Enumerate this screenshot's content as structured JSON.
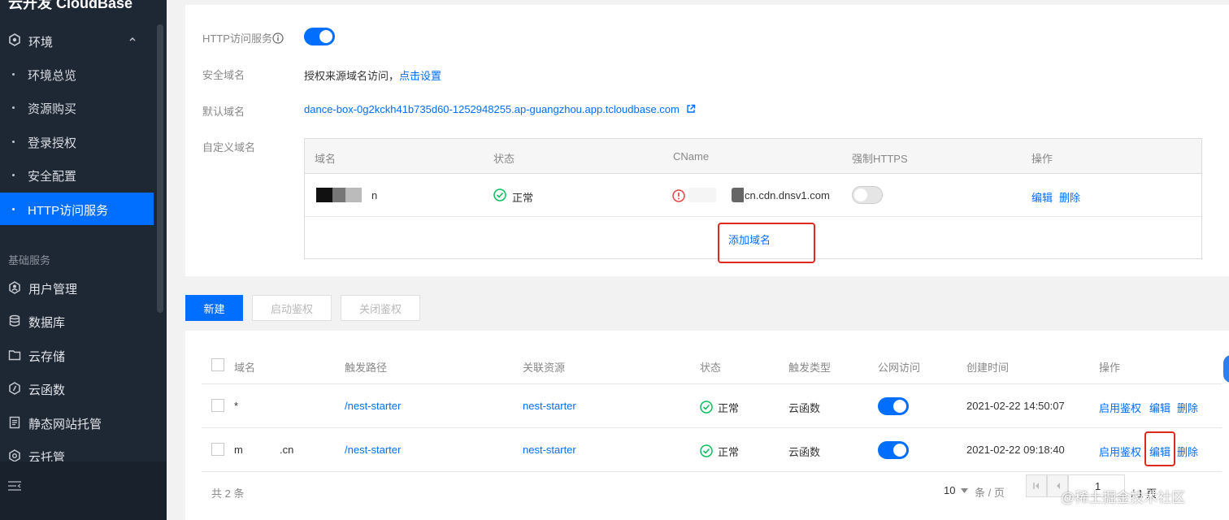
{
  "sidebar": {
    "brand": "云开发 CloudBase",
    "env": {
      "label": "环境",
      "icon": "hexagon-icon"
    },
    "sub_items": [
      {
        "label": "环境总览"
      },
      {
        "label": "资源购买"
      },
      {
        "label": "登录授权"
      },
      {
        "label": "安全配置"
      },
      {
        "label": "HTTP访问服务",
        "active": true
      }
    ],
    "group_title": "基础服务",
    "services": [
      {
        "label": "用户管理",
        "icon": "user-icon"
      },
      {
        "label": "数据库",
        "icon": "database-icon"
      },
      {
        "label": "云存储",
        "icon": "folder-icon"
      },
      {
        "label": "云函数",
        "icon": "function-icon"
      },
      {
        "label": "静态网站托管",
        "icon": "document-icon"
      },
      {
        "label": "云托管",
        "icon": "gear-icon"
      }
    ]
  },
  "http_service": {
    "label": "HTTP访问服务",
    "enabled": true,
    "secure_domain_label": "安全域名",
    "secure_domain_text": "授权来源域名访问，",
    "secure_domain_link": "点击设置",
    "default_domain_label": "默认域名",
    "default_domain": "dance-box-0g2kckh41b735d60-1252948255.ap-guangzhou.app.tcloudbase.com",
    "custom_domain_label": "自定义域名",
    "domain_table": {
      "headers": [
        "域名",
        "状态",
        "CName",
        "强制HTTPS",
        "操作"
      ],
      "rows": [
        {
          "domain": "n",
          "status": "正常",
          "cname": "cn.cdn.dnsv1.com",
          "force_https": false,
          "edit": "编辑",
          "delete": "删除"
        }
      ],
      "add_label": "添加域名"
    }
  },
  "toolbar": {
    "new_label": "新建",
    "enable_auth_label": "启动鉴权",
    "disable_auth_label": "关闭鉴权"
  },
  "routes": {
    "headers": [
      "域名",
      "触发路径",
      "关联资源",
      "状态",
      "触发类型",
      "公网访问",
      "创建时间",
      "操作"
    ],
    "rows": [
      {
        "domain": "*",
        "path": "/nest-starter",
        "resource": "nest-starter",
        "status": "正常",
        "type": "云函数",
        "public": true,
        "created": "2021-02-22 14:50:07",
        "auth": "启用鉴权",
        "edit": "编辑",
        "delete": "删除"
      },
      {
        "domain": "m",
        "domain_suffix": ".cn",
        "path": "/nest-starter",
        "resource": "nest-starter",
        "status": "正常",
        "type": "云函数",
        "public": true,
        "created": "2021-02-22 09:18:40",
        "auth": "启用鉴权",
        "edit": "编辑",
        "delete": "删除"
      }
    ],
    "total_text": "共 2 条",
    "page_size": "10",
    "page_size_unit": "条 / 页",
    "page_current": "1",
    "page_total": "/ 1 页"
  },
  "watermark": "@稀土掘金技术社区",
  "colors": {
    "primary": "#006eff",
    "sidebar_bg": "#1e2734",
    "success": "#0abf5b",
    "error": "#e54545",
    "highlight": "#e0291e"
  }
}
